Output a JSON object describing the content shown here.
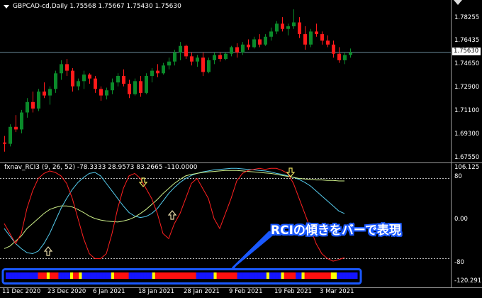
{
  "header": {
    "symbol_line": "GBPCAD-cd,Daily  1.75568 1.75667 1.75430 1.75630"
  },
  "indicator": {
    "title": "fxnav_RCI3 (9, 26, 52) -78.3333 28.9573 83.2665 -110.0000"
  },
  "price_axis": {
    "labels": [
      "1.78255",
      "1.76435",
      "1.74650",
      "1.72900",
      "1.71100",
      "1.69300",
      "1.67550"
    ],
    "current_price": "1.75630"
  },
  "indicator_axis": {
    "labels": [
      "106.125",
      "80",
      "0.00",
      "-80",
      "-120.2917"
    ]
  },
  "date_axis": {
    "labels": [
      "11 Dec 2020",
      "23 Dec 2020",
      "6 Jan 2021",
      "18 Jan 2021",
      "28 Jan 2021",
      "9 Feb 2021",
      "19 Feb 2021",
      "3 Mar 2021"
    ]
  },
  "annotation": {
    "text": "RCIの傾きをバーで表現"
  },
  "colors": {
    "bull": "#0a8a2a",
    "bear": "#ff1a1a",
    "rci_short": "#ff2020",
    "rci_mid": "#ccee88",
    "rci_long": "#55ccee",
    "highlight": "#1a58ff",
    "bar_blue": "#1515ff",
    "bar_red": "#ff1010",
    "bar_yellow": "#ffff00"
  },
  "candles": [
    [
      1.687,
      1.692,
      1.68,
      1.686
    ],
    [
      1.686,
      1.701,
      1.684,
      1.699
    ],
    [
      1.699,
      1.708,
      1.695,
      1.697
    ],
    [
      1.697,
      1.712,
      1.694,
      1.71
    ],
    [
      1.71,
      1.721,
      1.706,
      1.718
    ],
    [
      1.718,
      1.726,
      1.71,
      1.713
    ],
    [
      1.713,
      1.728,
      1.711,
      1.726
    ],
    [
      1.726,
      1.733,
      1.721,
      1.723
    ],
    [
      1.723,
      1.73,
      1.716,
      1.728
    ],
    [
      1.728,
      1.742,
      1.725,
      1.74
    ],
    [
      1.74,
      1.75,
      1.735,
      1.747
    ],
    [
      1.747,
      1.751,
      1.738,
      1.742
    ],
    [
      1.742,
      1.744,
      1.726,
      1.73
    ],
    [
      1.73,
      1.736,
      1.727,
      1.734
    ],
    [
      1.734,
      1.742,
      1.728,
      1.739
    ],
    [
      1.739,
      1.74,
      1.732,
      1.736
    ],
    [
      1.736,
      1.738,
      1.725,
      1.728
    ],
    [
      1.728,
      1.73,
      1.719,
      1.723
    ],
    [
      1.723,
      1.729,
      1.72,
      1.727
    ],
    [
      1.727,
      1.736,
      1.724,
      1.733
    ],
    [
      1.733,
      1.74,
      1.73,
      1.738
    ],
    [
      1.738,
      1.743,
      1.73,
      1.732
    ],
    [
      1.732,
      1.735,
      1.721,
      1.724
    ],
    [
      1.724,
      1.736,
      1.723,
      1.734
    ],
    [
      1.734,
      1.738,
      1.722,
      1.725
    ],
    [
      1.725,
      1.74,
      1.724,
      1.738
    ],
    [
      1.738,
      1.744,
      1.733,
      1.742
    ],
    [
      1.742,
      1.747,
      1.737,
      1.74
    ],
    [
      1.74,
      1.748,
      1.739,
      1.746
    ],
    [
      1.746,
      1.752,
      1.743,
      1.749
    ],
    [
      1.749,
      1.758,
      1.746,
      1.756
    ],
    [
      1.756,
      1.764,
      1.75,
      1.761
    ],
    [
      1.761,
      1.762,
      1.751,
      1.753
    ],
    [
      1.753,
      1.756,
      1.746,
      1.749
    ],
    [
      1.749,
      1.754,
      1.745,
      1.752
    ],
    [
      1.752,
      1.756,
      1.738,
      1.741
    ],
    [
      1.741,
      1.752,
      1.74,
      1.75
    ],
    [
      1.75,
      1.756,
      1.747,
      1.754
    ],
    [
      1.754,
      1.756,
      1.749,
      1.751
    ],
    [
      1.751,
      1.756,
      1.75,
      1.755
    ],
    [
      1.755,
      1.761,
      1.753,
      1.76
    ],
    [
      1.76,
      1.763,
      1.752,
      1.756
    ],
    [
      1.756,
      1.764,
      1.754,
      1.762
    ],
    [
      1.762,
      1.766,
      1.758,
      1.76
    ],
    [
      1.76,
      1.768,
      1.759,
      1.766
    ],
    [
      1.766,
      1.77,
      1.76,
      1.762
    ],
    [
      1.762,
      1.77,
      1.761,
      1.768
    ],
    [
      1.768,
      1.775,
      1.765,
      1.772
    ],
    [
      1.772,
      1.78,
      1.77,
      1.778
    ],
    [
      1.778,
      1.783,
      1.772,
      1.774
    ],
    [
      1.774,
      1.778,
      1.769,
      1.776
    ],
    [
      1.776,
      1.789,
      1.774,
      1.779
    ],
    [
      1.779,
      1.783,
      1.767,
      1.77
    ],
    [
      1.77,
      1.776,
      1.758,
      1.762
    ],
    [
      1.762,
      1.774,
      1.76,
      1.772
    ],
    [
      1.772,
      1.778,
      1.768,
      1.77
    ],
    [
      1.77,
      1.772,
      1.762,
      1.765
    ],
    [
      1.765,
      1.769,
      1.76,
      1.762
    ],
    [
      1.762,
      1.765,
      1.752,
      1.755
    ],
    [
      1.755,
      1.76,
      1.748,
      1.75
    ],
    [
      1.75,
      1.756,
      1.747,
      1.754
    ],
    [
      1.754,
      1.759,
      1.752,
      1.756
    ]
  ],
  "signal_bar": [
    "b",
    "b",
    "b",
    "b",
    "b",
    "b",
    "b",
    "b",
    "b",
    "b",
    "b",
    "r",
    "r",
    "r",
    "y",
    "r",
    "r",
    "r",
    "b",
    "b",
    "b",
    "b",
    "y",
    "r",
    "r",
    "y",
    "b",
    "b",
    "b",
    "b",
    "b",
    "b",
    "b",
    "b",
    "b",
    "b",
    "y",
    "r",
    "r",
    "r",
    "r",
    "r",
    "b",
    "b",
    "b",
    "b",
    "b",
    "b",
    "b",
    "b",
    "y",
    "r",
    "r",
    "r",
    "r",
    "r",
    "r",
    "r",
    "r",
    "r",
    "r",
    "r",
    "r",
    "r",
    "r",
    "b",
    "b",
    "b",
    "b",
    "b",
    "b",
    "y",
    "r",
    "r",
    "r",
    "r",
    "r",
    "r",
    "r",
    "b",
    "b",
    "b",
    "b",
    "b",
    "b",
    "b",
    "b",
    "b",
    "b",
    "y",
    "b",
    "b",
    "b",
    "b",
    "y",
    "r",
    "r",
    "r",
    "r",
    "b",
    "b",
    "y",
    "r",
    "r",
    "r",
    "r",
    "r",
    "r",
    "r",
    "r",
    "r",
    "y",
    "y",
    "b",
    "b",
    "b",
    "b",
    "b",
    "b",
    "b"
  ]
}
